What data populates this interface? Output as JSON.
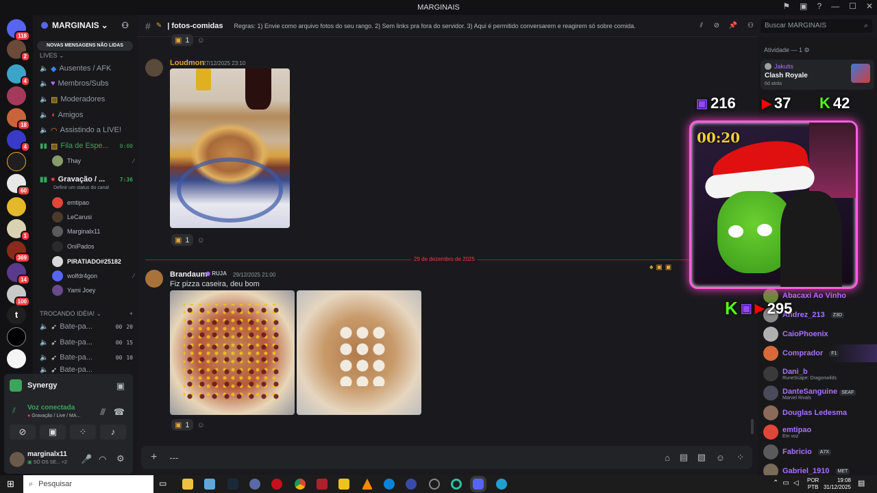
{
  "window": {
    "title": "MARGINAIS"
  },
  "server": {
    "name": "MARGINAIS",
    "new_messages_banner": "NOVAS MENSAGENS NÃO LIDAS"
  },
  "guild_badges": [
    "118",
    "2",
    "4",
    "4",
    "18",
    "4",
    "60",
    "1",
    "369",
    "14",
    "100"
  ],
  "sidebar": {
    "category_lives": "LIVES",
    "channels": [
      {
        "label": "Ausentes / AFK"
      },
      {
        "label": "Membros/Subs"
      },
      {
        "label": "Moderadores"
      },
      {
        "label": "Amigos"
      },
      {
        "label": "Assistindo a LIVE!"
      },
      {
        "label": "Fila de Espe...",
        "timer": "0:00"
      },
      {
        "label": "Gravação / ...",
        "timer": "7:36"
      }
    ],
    "fila_user": "Thay",
    "gravacao_status": "Definir um status do canal",
    "gravacao_users": [
      "emtipao",
      "LeCarusi",
      "Marginalx11",
      "OniPados",
      "PIRATIADO#25182",
      "wolfdr4gon",
      "Yami Joey"
    ],
    "category_trocando": "TROCANDO IDÉIA!",
    "bate_papos": [
      {
        "label": "Bate-pa...",
        "a": "00",
        "b": "20"
      },
      {
        "label": "Bate-pa...",
        "a": "00",
        "b": "15"
      },
      {
        "label": "Bate-pa...",
        "a": "00",
        "b": "10"
      },
      {
        "label": "Bate-pa..."
      }
    ]
  },
  "voice": {
    "app": "Synergy",
    "status": "Voz conectada",
    "channel": "Gravação / Live / MA..."
  },
  "user": {
    "name": "marginalx11",
    "status": "SÓ OS SE...",
    "extra": "+2"
  },
  "channel": {
    "name": "| fotos-comidas",
    "topic": "Regras: 1) Envie como arquivo fotos do seu rango. 2) Sem links pra fora do servidor. 3) Aqui é permitido conversarem e reagirem só sobre comida."
  },
  "search": {
    "placeholder": "Buscar MARGINAIS"
  },
  "messages": [
    {
      "author": "Loudmon",
      "timestamp": "27/12/2025 23:10",
      "reaction_count": "1"
    },
    {
      "author": "Brandaum",
      "tag": "RUJA",
      "timestamp": "29/12/2025 21:00",
      "text": "Fiz pizza caseira, deu bom",
      "reaction_count": "1"
    }
  ],
  "top_reaction_count": "1",
  "date_divider": "29 de dezembro de 2025",
  "composer": {
    "placeholder": "---"
  },
  "members": {
    "activity_header": "Atividade — 1",
    "activity_user": "Jakutis",
    "activity_game": "Clash Royale",
    "activity_time": "6d atrás",
    "list": [
      {
        "name": "Abacaxi Ao Vinho",
        "color": "#a970ff"
      },
      {
        "name": "Andrez_213",
        "tag": "Z3D",
        "color": "#a970ff"
      },
      {
        "name": "CaioPhoenix",
        "color": "#a970ff"
      },
      {
        "name": "Comprador",
        "tag": "F1",
        "color": "#a970ff"
      },
      {
        "name": "Dani_b",
        "sub": "RuneScape: Dragonwilds",
        "color": "#a970ff"
      },
      {
        "name": "DanteSanguine",
        "tag": "SEAF",
        "sub": "Marvel Rivals",
        "color": "#a970ff"
      },
      {
        "name": "Douglas Ledesma",
        "color": "#a970ff"
      },
      {
        "name": "emtipao",
        "sub": "Em voz",
        "color": "#a970ff"
      },
      {
        "name": "Fabricio",
        "tag": "A7X",
        "color": "#a970ff"
      },
      {
        "name": "Gabriel_1910",
        "tag": "MET",
        "color": "#a970ff"
      }
    ]
  },
  "overlay": {
    "timer": "00:20",
    "twitch_count": "216",
    "youtube_count": "37",
    "kick_count": "42",
    "bottom_count": "295"
  },
  "taskbar": {
    "search": "Pesquisar",
    "lang1": "POR",
    "lang2": "PTB",
    "time": "19:08",
    "date": "31/12/2025"
  },
  "colors": {
    "accent": "#5865f2",
    "online": "#23a55a",
    "danger": "#f23f42",
    "twitch": "#9146ff",
    "kick": "#53fc18",
    "youtube": "#ff0000"
  }
}
